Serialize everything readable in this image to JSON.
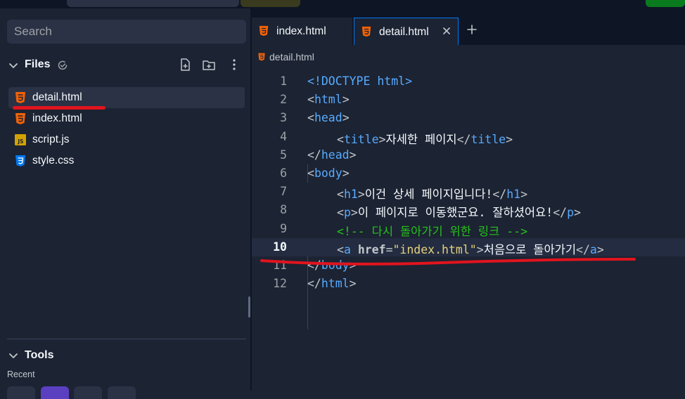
{
  "search": {
    "placeholder": "Search"
  },
  "files": {
    "title": "Files",
    "items": [
      {
        "name": "detail.html",
        "icon": "html5-icon",
        "selected": true
      },
      {
        "name": "index.html",
        "icon": "html5-icon"
      },
      {
        "name": "script.js",
        "icon": "javascript-icon"
      },
      {
        "name": "style.css",
        "icon": "css3-icon"
      }
    ]
  },
  "tools": {
    "title": "Tools",
    "recent_label": "Recent"
  },
  "tabs": [
    {
      "label": "index.html",
      "icon": "html5-icon"
    },
    {
      "label": "detail.html",
      "icon": "html5-icon",
      "active": true
    }
  ],
  "breadcrumb": {
    "file": "detail.html"
  },
  "editor": {
    "active_line": 10,
    "lines": [
      {
        "n": "1"
      },
      {
        "n": "2"
      },
      {
        "n": "3"
      },
      {
        "n": "4"
      },
      {
        "n": "5"
      },
      {
        "n": "6"
      },
      {
        "n": "7"
      },
      {
        "n": "8"
      },
      {
        "n": "9"
      },
      {
        "n": "10"
      },
      {
        "n": "11"
      },
      {
        "n": "12"
      }
    ],
    "code": {
      "doctype": "<!DOCTYPE html>",
      "html_tag": "html",
      "head_tag": "head",
      "title_tag": "title",
      "title_text": "자세한 페이지",
      "body_tag": "body",
      "h1_tag": "h1",
      "h1_text": "이건 상세 페이지입니다!",
      "p_tag": "p",
      "p_text": "이 페이지로 이동했군요. 잘하셨어요!",
      "comment": "<!-- 다시 돌아가기 위한 링크 -->",
      "a_tag": "a",
      "a_attr": "href",
      "a_eq": "=",
      "a_value": "\"index.html\"",
      "a_text": "처음으로 돌아가기"
    }
  },
  "colors": {
    "accent": "#0079f2",
    "annotation": "#e0141e",
    "html_icon": "#f26207",
    "js_icon": "#d4a200",
    "css_icon": "#0079f2",
    "tag": "#57abff",
    "string": "#e7d17e",
    "comment": "#25c21a"
  }
}
